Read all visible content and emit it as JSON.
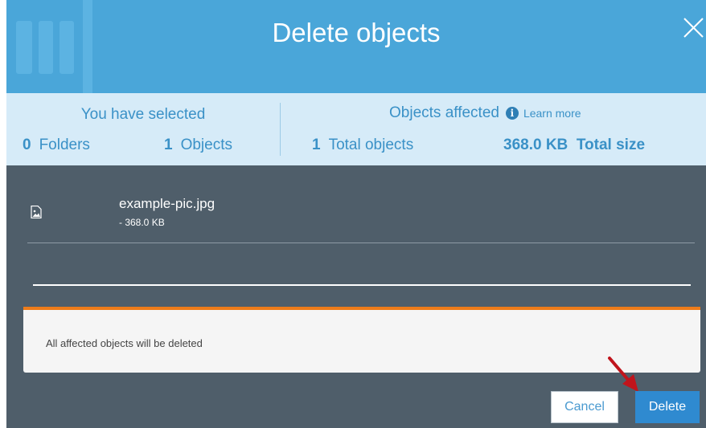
{
  "dialog": {
    "title": "Delete objects",
    "close_icon": "close-icon"
  },
  "summary": {
    "selected_title": "You have selected",
    "folders_count": "0",
    "folders_label": "Folders",
    "objects_count": "1",
    "objects_label": "Objects",
    "affected_title": "Objects affected",
    "info_icon": "info-icon",
    "learn_more": "Learn more",
    "total_objects_count": "1",
    "total_objects_label": "Total objects",
    "total_size_value": "368.0 KB",
    "total_size_label": "Total size"
  },
  "files": [
    {
      "name": "example-pic.jpg",
      "size": "- 368.0 KB",
      "icon": "image-file-icon"
    }
  ],
  "warning": {
    "text": "All affected objects will be deleted"
  },
  "actions": {
    "cancel_label": "Cancel",
    "delete_label": "Delete"
  },
  "colors": {
    "header": "#4aa6d9",
    "summary_bg": "#d6ebf8",
    "summary_text": "#3a91c7",
    "body_bg": "#4f5e6a",
    "warning_border": "#ee7c1a",
    "delete_button": "#2f8ad0",
    "annotation_arrow": "#c0141c"
  }
}
